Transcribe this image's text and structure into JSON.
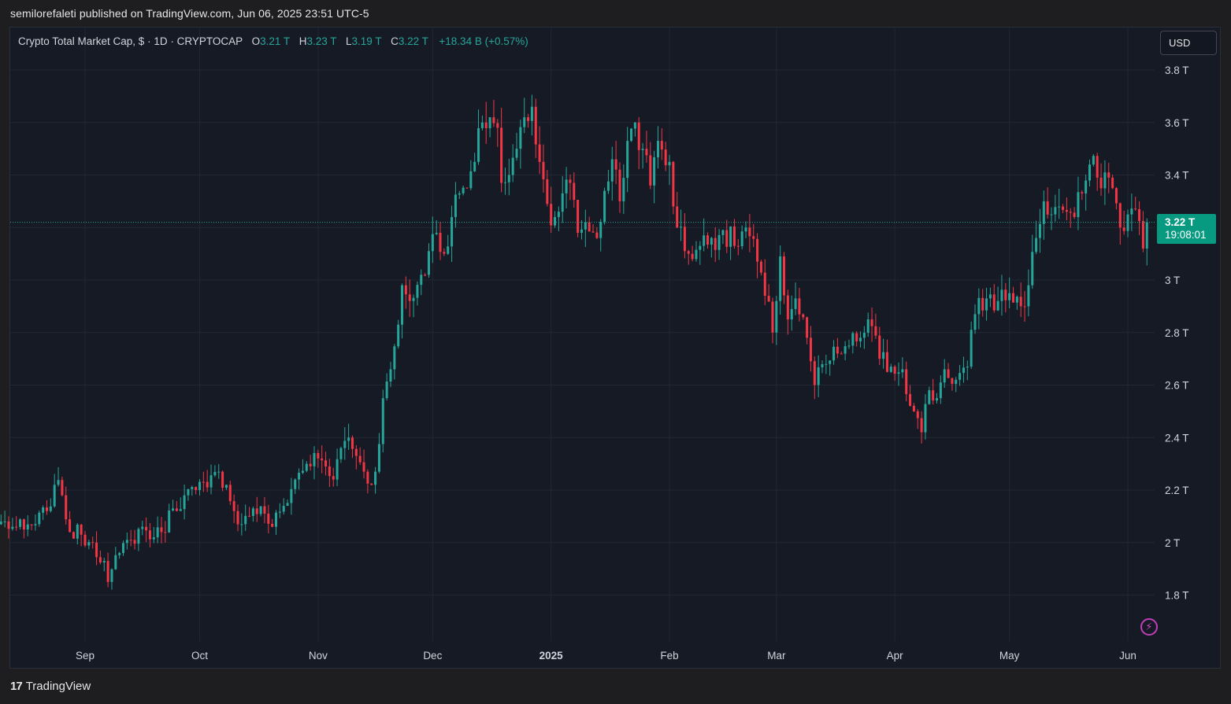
{
  "header": {
    "published": "semilorefaleti published on TradingView.com, Jun 06, 2025 23:51 UTC-5"
  },
  "legend": {
    "title": "Crypto Total Market Cap, $ · 1D · CRYPTOCAP",
    "open_label": "O",
    "open": "3.21 T",
    "high_label": "H",
    "high": "3.23 T",
    "low_label": "L",
    "low": "3.19 T",
    "close_label": "C",
    "close": "3.22 T",
    "change": "+18.34 B (+0.57%)"
  },
  "currency_button": "USD",
  "price_badge": {
    "price": "3.22 T",
    "countdown": "19:08:01"
  },
  "footer": {
    "brand": "TradingView",
    "logo": "17"
  },
  "colors": {
    "up": "#26a69a",
    "down": "#f23645",
    "badge": "#089981",
    "background": "#161a25",
    "grid": "#232733"
  },
  "icons": {
    "alert": "lightning-icon"
  },
  "chart_data": {
    "type": "candlestick",
    "interval": "1D",
    "symbol": "CRYPTOCAP",
    "y_unit": "T",
    "y_ticks": [
      {
        "value": 1.8,
        "label": "1.8 T"
      },
      {
        "value": 2.0,
        "label": "2 T"
      },
      {
        "value": 2.2,
        "label": "2.2 T"
      },
      {
        "value": 2.4,
        "label": "2.4 T"
      },
      {
        "value": 2.6,
        "label": "2.6 T"
      },
      {
        "value": 2.8,
        "label": "2.8 T"
      },
      {
        "value": 3.0,
        "label": "3 T"
      },
      {
        "value": 3.2,
        "label": "3.2 T"
      },
      {
        "value": 3.4,
        "label": "3.4 T"
      },
      {
        "value": 3.6,
        "label": "3.6 T"
      },
      {
        "value": 3.8,
        "label": "3.8 T"
      }
    ],
    "y_ticks_labeled": [
      1.8,
      2.0,
      2.2,
      2.4,
      2.6,
      2.8,
      3.0,
      3.4,
      3.6,
      3.8
    ],
    "ylim": [
      1.65,
      3.85
    ],
    "x_ticks": [
      {
        "date": "2024-09-01",
        "label": "Sep",
        "bold": false
      },
      {
        "date": "2024-10-01",
        "label": "Oct",
        "bold": false
      },
      {
        "date": "2024-11-01",
        "label": "Nov",
        "bold": false
      },
      {
        "date": "2024-12-01",
        "label": "Dec",
        "bold": false
      },
      {
        "date": "2025-01-01",
        "label": "2025",
        "bold": true
      },
      {
        "date": "2025-02-01",
        "label": "Feb",
        "bold": false
      },
      {
        "date": "2025-03-01",
        "label": "Mar",
        "bold": false
      },
      {
        "date": "2025-04-01",
        "label": "Apr",
        "bold": false
      },
      {
        "date": "2025-05-01",
        "label": "May",
        "bold": false
      },
      {
        "date": "2025-06-01",
        "label": "Jun",
        "bold": false
      }
    ],
    "current_price": 3.22,
    "series": [
      {
        "name": "",
        "closes": [
          [
            "2024-08-10",
            2.08
          ],
          [
            "2024-08-13",
            2.06
          ],
          [
            "2024-08-16",
            2.05
          ],
          [
            "2024-08-19",
            2.07
          ],
          [
            "2024-08-22",
            2.12
          ],
          [
            "2024-08-24",
            2.22
          ],
          [
            "2024-08-26",
            2.18
          ],
          [
            "2024-08-28",
            2.04
          ],
          [
            "2024-08-31",
            2.03
          ],
          [
            "2024-09-03",
            2.0
          ],
          [
            "2024-09-06",
            1.93
          ],
          [
            "2024-09-07",
            1.85
          ],
          [
            "2024-09-10",
            1.96
          ],
          [
            "2024-09-13",
            2.01
          ],
          [
            "2024-09-16",
            2.06
          ],
          [
            "2024-09-19",
            2.02
          ],
          [
            "2024-09-21",
            2.04
          ],
          [
            "2024-09-24",
            2.13
          ],
          [
            "2024-09-27",
            2.18
          ],
          [
            "2024-09-30",
            2.2
          ],
          [
            "2024-10-03",
            2.21
          ],
          [
            "2024-10-06",
            2.27
          ],
          [
            "2024-10-08",
            2.22
          ],
          [
            "2024-10-10",
            2.12
          ],
          [
            "2024-10-12",
            2.07
          ],
          [
            "2024-10-15",
            2.13
          ],
          [
            "2024-10-18",
            2.11
          ],
          [
            "2024-10-20",
            2.06
          ],
          [
            "2024-10-23",
            2.14
          ],
          [
            "2024-10-26",
            2.24
          ],
          [
            "2024-10-29",
            2.3
          ],
          [
            "2024-11-01",
            2.32
          ],
          [
            "2024-11-03",
            2.29
          ],
          [
            "2024-11-05",
            2.24
          ],
          [
            "2024-11-07",
            2.36
          ],
          [
            "2024-11-09",
            2.4
          ],
          [
            "2024-11-11",
            2.33
          ],
          [
            "2024-11-13",
            2.27
          ],
          [
            "2024-11-15",
            2.22
          ],
          [
            "2024-11-16",
            2.27
          ],
          [
            "2024-11-18",
            2.55
          ],
          [
            "2024-11-20",
            2.66
          ],
          [
            "2024-11-22",
            2.83
          ],
          [
            "2024-11-23",
            2.98
          ],
          [
            "2024-11-25",
            2.92
          ],
          [
            "2024-11-28",
            3.02
          ],
          [
            "2024-11-30",
            3.11
          ],
          [
            "2024-12-02",
            3.18
          ],
          [
            "2024-12-04",
            3.1
          ],
          [
            "2024-12-06",
            3.24
          ],
          [
            "2024-12-08",
            3.33
          ],
          [
            "2024-12-10",
            3.35
          ],
          [
            "2024-12-12",
            3.45
          ],
          [
            "2024-12-14",
            3.6
          ],
          [
            "2024-12-16",
            3.62
          ],
          [
            "2024-12-18",
            3.58
          ],
          [
            "2024-12-19",
            3.37
          ],
          [
            "2024-12-21",
            3.4
          ],
          [
            "2024-12-23",
            3.5
          ],
          [
            "2024-12-25",
            3.62
          ],
          [
            "2024-12-27",
            3.66
          ],
          [
            "2024-12-29",
            3.45
          ],
          [
            "2024-12-31",
            3.29
          ],
          [
            "2025-01-02",
            3.24
          ],
          [
            "2025-01-04",
            3.33
          ],
          [
            "2025-01-06",
            3.37
          ],
          [
            "2025-01-08",
            3.18
          ],
          [
            "2025-01-10",
            3.22
          ],
          [
            "2025-01-13",
            3.16
          ],
          [
            "2025-01-15",
            3.34
          ],
          [
            "2025-01-17",
            3.46
          ],
          [
            "2025-01-19",
            3.3
          ],
          [
            "2025-01-21",
            3.53
          ],
          [
            "2025-01-23",
            3.6
          ],
          [
            "2025-01-25",
            3.5
          ],
          [
            "2025-01-27",
            3.36
          ],
          [
            "2025-01-29",
            3.53
          ],
          [
            "2025-02-01",
            3.45
          ],
          [
            "2025-02-02",
            3.28
          ],
          [
            "2025-02-03",
            3.2
          ],
          [
            "2025-02-06",
            3.1
          ],
          [
            "2025-02-09",
            3.13
          ],
          [
            "2025-02-12",
            3.16
          ],
          [
            "2025-02-15",
            3.19
          ],
          [
            "2025-02-18",
            3.13
          ],
          [
            "2025-02-21",
            3.2
          ],
          [
            "2025-02-24",
            3.07
          ],
          [
            "2025-02-26",
            2.94
          ],
          [
            "2025-02-28",
            2.8
          ],
          [
            "2025-03-02",
            3.09
          ],
          [
            "2025-03-04",
            2.85
          ],
          [
            "2025-03-06",
            2.93
          ],
          [
            "2025-03-09",
            2.78
          ],
          [
            "2025-03-11",
            2.6
          ],
          [
            "2025-03-14",
            2.68
          ],
          [
            "2025-03-17",
            2.72
          ],
          [
            "2025-03-20",
            2.75
          ],
          [
            "2025-03-23",
            2.78
          ],
          [
            "2025-03-25",
            2.85
          ],
          [
            "2025-03-28",
            2.7
          ],
          [
            "2025-03-31",
            2.67
          ],
          [
            "2025-04-03",
            2.66
          ],
          [
            "2025-04-06",
            2.5
          ],
          [
            "2025-04-08",
            2.42
          ],
          [
            "2025-04-10",
            2.58
          ],
          [
            "2025-04-12",
            2.55
          ],
          [
            "2025-04-14",
            2.66
          ],
          [
            "2025-04-17",
            2.62
          ],
          [
            "2025-04-20",
            2.67
          ],
          [
            "2025-04-22",
            2.87
          ],
          [
            "2025-04-25",
            2.93
          ],
          [
            "2025-04-28",
            2.92
          ],
          [
            "2025-05-01",
            2.95
          ],
          [
            "2025-05-04",
            2.9
          ],
          [
            "2025-05-06",
            2.98
          ],
          [
            "2025-05-08",
            3.16
          ],
          [
            "2025-05-10",
            3.3
          ],
          [
            "2025-05-12",
            3.25
          ],
          [
            "2025-05-14",
            3.28
          ],
          [
            "2025-05-16",
            3.26
          ],
          [
            "2025-05-18",
            3.24
          ],
          [
            "2025-05-20",
            3.33
          ],
          [
            "2025-05-22",
            3.44
          ],
          [
            "2025-05-24",
            3.39
          ],
          [
            "2025-05-26",
            3.41
          ],
          [
            "2025-05-28",
            3.35
          ],
          [
            "2025-05-30",
            3.2
          ],
          [
            "2025-06-01",
            3.25
          ],
          [
            "2025-06-03",
            3.27
          ],
          [
            "2025-06-05",
            3.12
          ],
          [
            "2025-06-06",
            3.22
          ]
        ]
      }
    ]
  }
}
